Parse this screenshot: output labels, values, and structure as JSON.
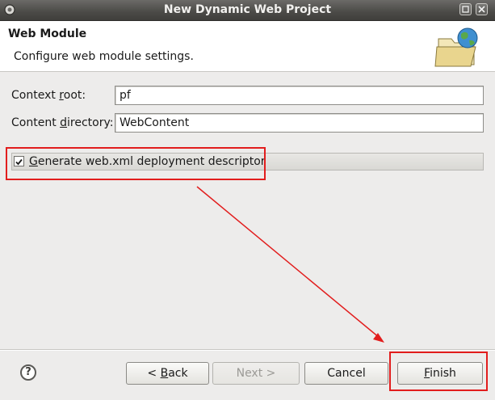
{
  "window": {
    "title": "New Dynamic Web Project"
  },
  "header": {
    "title": "Web Module",
    "description": "Configure web module settings.",
    "icon": "web-folder-globe-icon"
  },
  "form": {
    "context_root": {
      "label_pre": "Context ",
      "label_u": "r",
      "label_post": "oot:",
      "value": "pf"
    },
    "content_directory": {
      "label_pre": "Content ",
      "label_u": "d",
      "label_post": "irectory:",
      "value": "WebContent"
    },
    "generate_descriptor": {
      "label_u": "G",
      "label_post": "enerate web.xml deployment descriptor",
      "checked": true
    }
  },
  "buttons": {
    "help": "?",
    "back": {
      "pre": "< ",
      "u": "B",
      "post": "ack"
    },
    "next": "Next >",
    "cancel": "Cancel",
    "finish": {
      "u": "F",
      "post": "inish"
    }
  },
  "colors": {
    "highlight": "#e21d1d",
    "titlebar": "#4b4a47"
  }
}
